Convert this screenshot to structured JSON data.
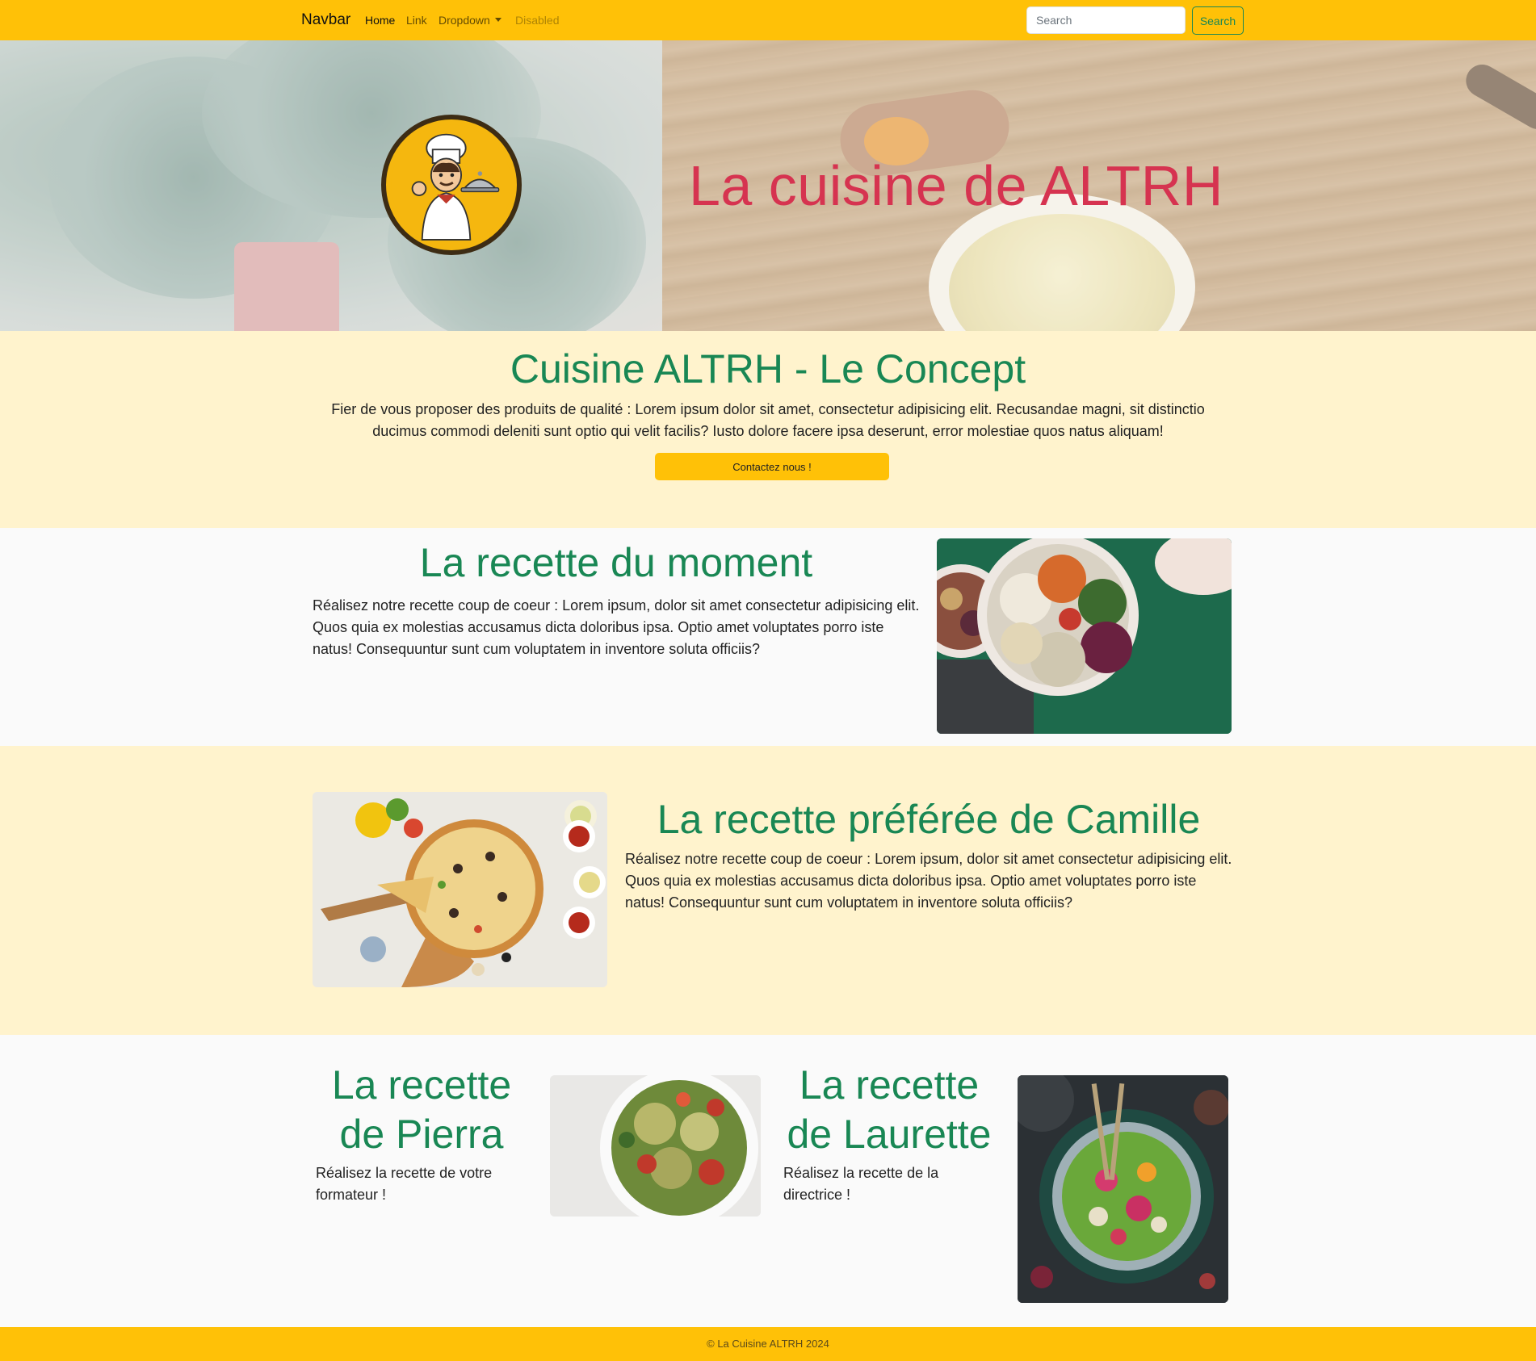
{
  "navbar": {
    "brand": "Navbar",
    "links": [
      {
        "label": "Home"
      },
      {
        "label": "Link"
      },
      {
        "label": "Dropdown"
      },
      {
        "label": "Disabled"
      }
    ],
    "search_placeholder": "Search",
    "search_button": "Search"
  },
  "hero": {
    "title": "La cuisine de ALTRH"
  },
  "concept": {
    "title": "Cuisine ALTRH - Le Concept",
    "text": "Fier de vous proposer des produits de qualité : Lorem ipsum dolor sit amet, consectetur adipisicing elit. Recusandae magni, sit distinctio ducimus commodi deleniti sunt optio qui velit facilis? Iusto dolore facere ipsa deserunt, error molestiae quos natus aliquam!",
    "button": "Contactez nous !"
  },
  "moment": {
    "title": "La recette du moment",
    "text": "Réalisez notre recette coup de coeur : Lorem ipsum, dolor sit amet consectetur adipisicing elit. Quos quia ex molestias accusamus dicta doloribus ipsa. Optio amet voluptates porro iste natus! Consequuntur sunt cum voluptatem in inventore soluta officiis?"
  },
  "camille": {
    "title": "La recette préférée de Camille",
    "text": "Réalisez notre recette coup de coeur : Lorem ipsum, dolor sit amet consectetur adipisicing elit. Quos quia ex molestias accusamus dicta doloribus ipsa. Optio amet voluptates porro iste natus! Consequuntur sunt cum voluptatem in inventore soluta officiis?"
  },
  "pierra": {
    "title_line1": "La recette",
    "title_line2": "de Pierra",
    "text": "Réalisez la recette de votre formateur !"
  },
  "laurette": {
    "title_line1": "La recette",
    "title_line2": "de Laurette",
    "text": "Réalisez la recette de la directrice !"
  },
  "footer": {
    "text": "© La Cuisine ALTRH 2024"
  },
  "colors": {
    "brand_yellow": "#ffc107",
    "cream": "#fff3cd",
    "green_title": "#198754",
    "hero_title": "#d63350"
  }
}
